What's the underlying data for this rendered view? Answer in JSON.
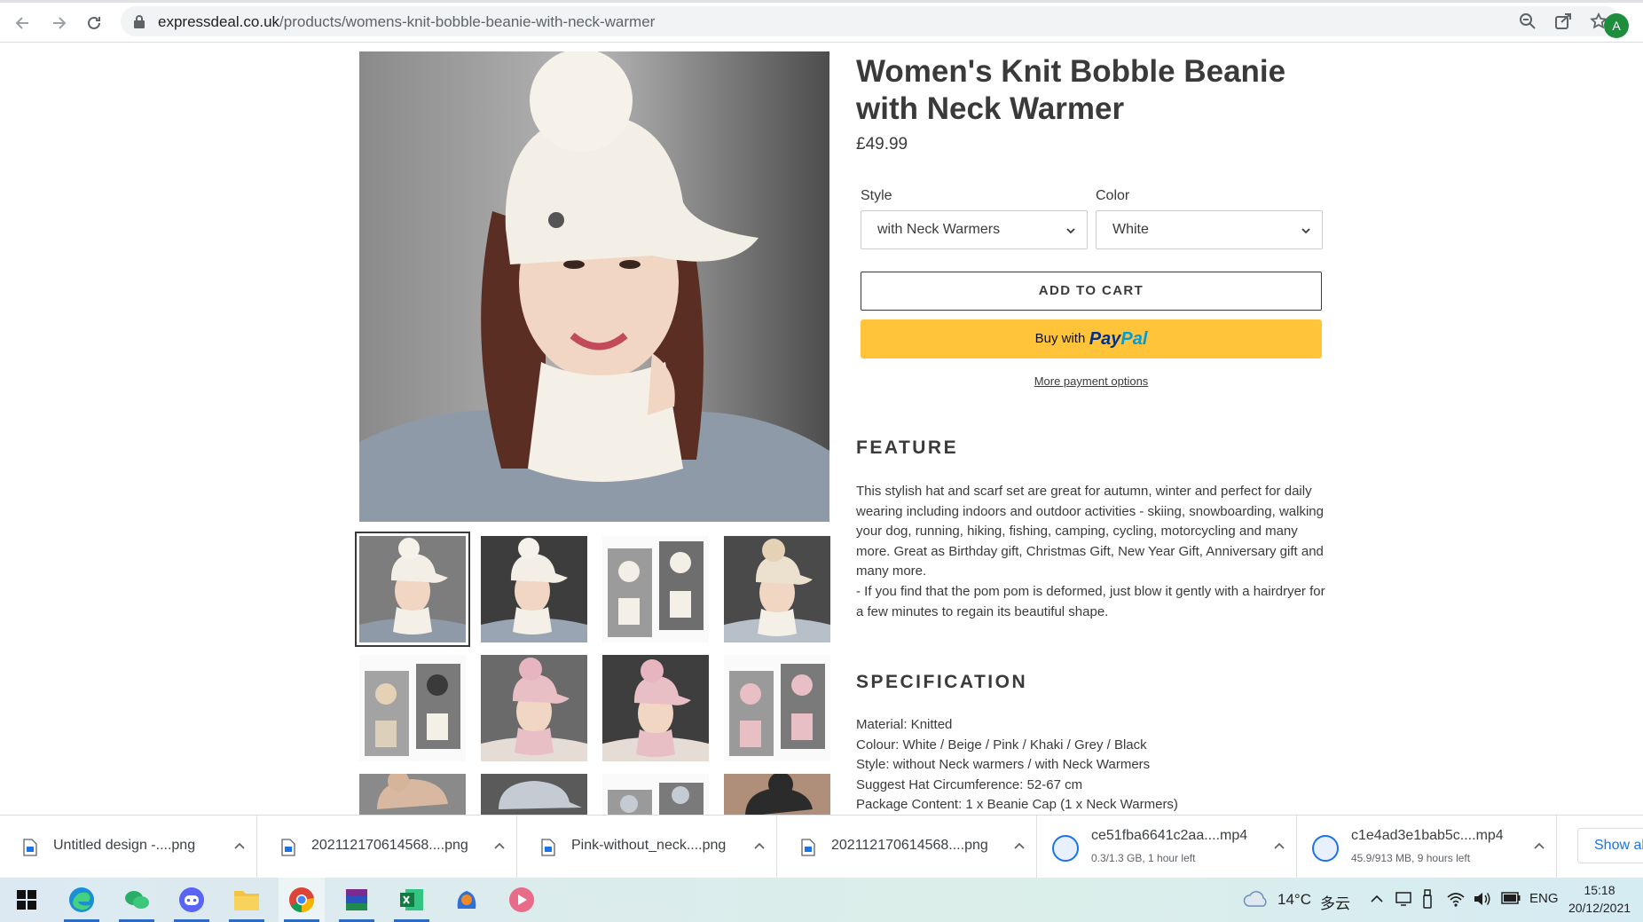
{
  "browser": {
    "url_domain": "expressdeal.co.uk",
    "url_path": "/products/womens-knit-bobble-beanie-with-neck-warmer",
    "profile_initial": "A"
  },
  "product": {
    "title": "Women's Knit Bobble Beanie with Neck Warmer",
    "price": "£49.99",
    "style_label": "Style",
    "style_value": "with Neck Warmers",
    "color_label": "Color",
    "color_value": "White",
    "add_to_cart": "ADD TO CART",
    "paypal_buy": "Buy with",
    "paypal_pay": "Pay",
    "paypal_pal": "Pal",
    "more_payment": "More payment options"
  },
  "feature": {
    "heading": "FEATURE",
    "text1": "This stylish hat and scarf set are great for autumn, winter and perfect for daily wearing including indoors and outdoor activities - skiing, snowboarding, walking your dog, running, hiking, fishing, camping, cycling, motorcycling and many more. Great as Birthday gift, Christmas Gift, New Year Gift, Anniversary gift and many more.",
    "text2": "- If you find that the pom pom is deformed, just blow it gently with a hairdryer for a few minutes to regain its beautiful shape."
  },
  "specification": {
    "heading": "SPECIFICATION",
    "lines": [
      "Material: Knitted",
      "Colour: White / Beige / Pink / Khaki / Grey / Black",
      "Style: without Neck warmers / with Neck Warmers",
      "Suggest Hat Circumference: 52-67 cm",
      "Package Content: 1 x Beanie Cap (1 x Neck Warmers)"
    ]
  },
  "colors": {
    "paypal_yellow": "#ffc439",
    "paypal_dark": "#003087",
    "paypal_light": "#009cde",
    "text": "#3a3a3a",
    "white_knit": "#f3efe6",
    "pink_knit": "#e9bfc6",
    "beige_knit": "#e5d2b6",
    "grey_knit": "#c5cbd3",
    "black_knit": "#2b2b2b"
  },
  "downloads": [
    {
      "name": "Untitled design -....png",
      "status": ""
    },
    {
      "name": "202112170614568....png",
      "status": ""
    },
    {
      "name": "Pink-without_neck....png",
      "status": ""
    },
    {
      "name": "202112170614568....png",
      "status": ""
    },
    {
      "name": "ce51fba6641c2aa....mp4",
      "status": "0.3/1.3 GB, 1 hour left"
    },
    {
      "name": "c1e4ad3e1bab5c....mp4",
      "status": "45.9/913 MB, 9 hours left"
    }
  ],
  "show_all": "Show all",
  "taskbar": {
    "weather": "14°C",
    "weather_desc": "多云",
    "language": "ENG",
    "time": "15:18",
    "date": "20/12/2021"
  }
}
